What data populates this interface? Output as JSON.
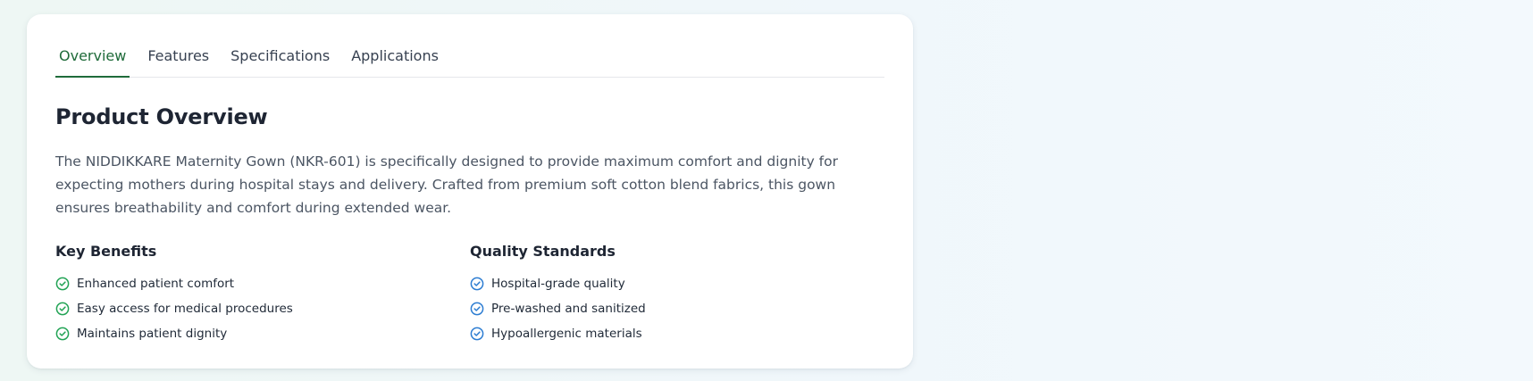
{
  "tabs": [
    {
      "label": "Overview",
      "active": true
    },
    {
      "label": "Features",
      "active": false
    },
    {
      "label": "Specifications",
      "active": false
    },
    {
      "label": "Applications",
      "active": false
    }
  ],
  "overview": {
    "title": "Product Overview",
    "description": "The NIDDIKKARE Maternity Gown (NKR-601) is specifically designed to provide maximum comfort and dignity for expecting mothers during hospital stays and delivery. Crafted from premium soft cotton blend fabrics, this gown ensures breathability and comfort during extended wear."
  },
  "key_benefits": {
    "title": "Key Benefits",
    "icon": "check-circle-icon",
    "icon_color": "#22a355",
    "items": [
      "Enhanced patient comfort",
      "Easy access for medical procedures",
      "Maintains patient dignity"
    ]
  },
  "quality_standards": {
    "title": "Quality Standards",
    "icon": "check-circle-icon",
    "icon_color": "#2d7dd2",
    "items": [
      "Hospital-grade quality",
      "Pre-washed and sanitized",
      "Hypoallergenic materials"
    ]
  },
  "colors": {
    "accent": "#1f6b3a",
    "text_dark": "#1e2533",
    "text_muted": "#4b5563"
  }
}
